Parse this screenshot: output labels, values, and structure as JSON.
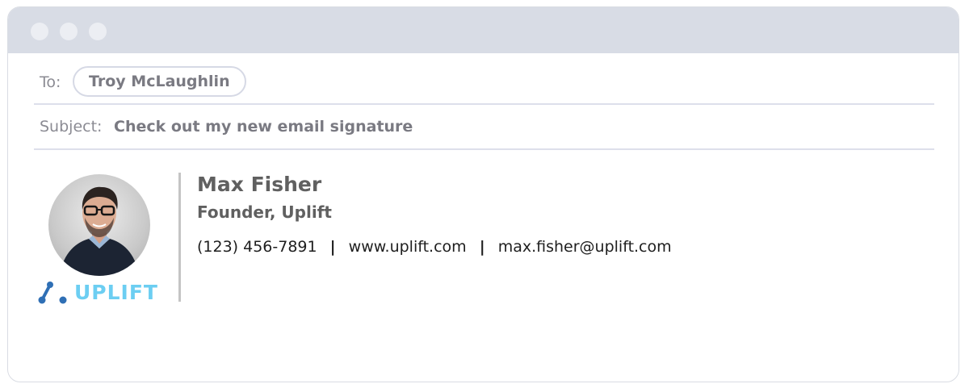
{
  "window": {
    "controls": [
      "close",
      "minimize",
      "maximize"
    ]
  },
  "to": {
    "label": "To:",
    "recipient": "Troy McLaughlin"
  },
  "subject": {
    "label": "Subject:",
    "value": "Check out my new email signature"
  },
  "signature": {
    "name": "Max Fisher",
    "title": "Founder, Uplift",
    "phone": "(123) 456-7891",
    "separator": "|",
    "website": "www.uplift.com",
    "email": "max.fisher@uplift.com",
    "logo_text": "UPLIFT",
    "colors": {
      "logo_text": "#6ccef2",
      "logo_icon": "#2f6fb5",
      "divider": "#c4c4c4"
    }
  }
}
